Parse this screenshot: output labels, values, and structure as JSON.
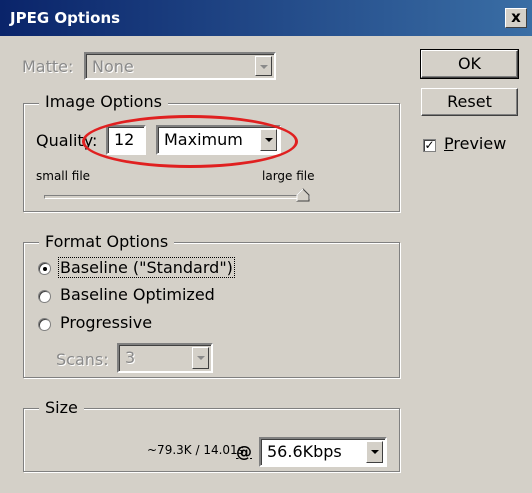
{
  "window": {
    "title": "JPEG Options",
    "close_label": "x"
  },
  "matte": {
    "label": "Matte:",
    "value": "None"
  },
  "buttons": {
    "ok": "OK",
    "reset": "Reset"
  },
  "preview": {
    "label": "Preview",
    "checked": true
  },
  "image_options": {
    "title": "Image Options",
    "quality_label": "Quality:",
    "quality_value": "12",
    "quality_preset": "Maximum",
    "slider_min_label": "small file",
    "slider_max_label": "large file",
    "slider_level": 1.0
  },
  "format_options": {
    "title": "Format Options",
    "options": [
      "Baseline (\"Standard\")",
      "Baseline Optimized",
      "Progressive"
    ],
    "selected_index": 0,
    "scans_label": "Scans:",
    "scans_value": "3"
  },
  "size": {
    "title": "Size",
    "estimate": "~79.3K / 14.01s",
    "at_symbol": "@",
    "speed": "56.6Kbps"
  },
  "annotation_color": "#e02020"
}
